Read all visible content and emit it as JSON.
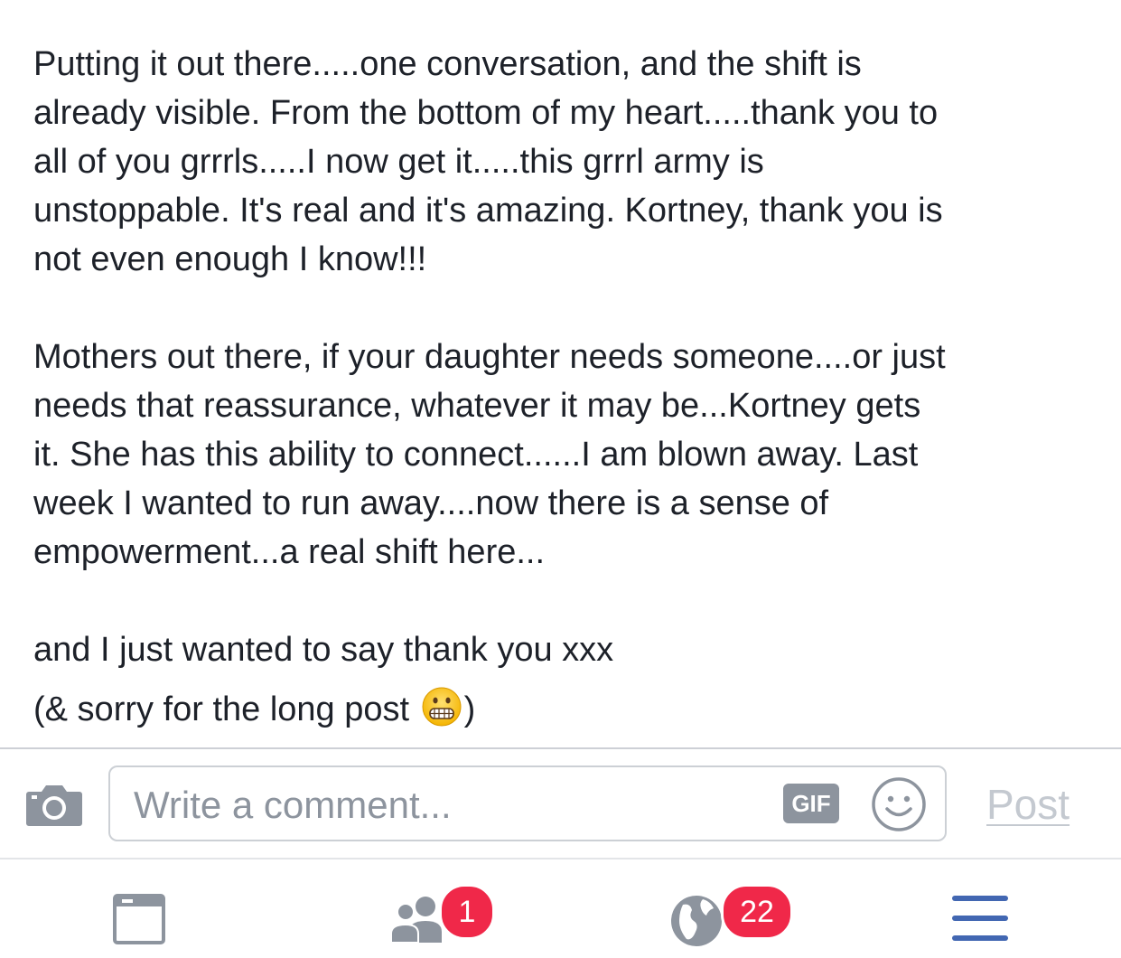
{
  "post": {
    "paragraph1": [
      "Putting it out there.....one conversation, and the shift is",
      "already visible. From the bottom of my heart.....thank you to",
      "all of you grrrls.....I now get it.....this grrrl army is",
      "unstoppable. It's real and it's amazing. Kortney, thank you is",
      "not even enough I know!!!"
    ],
    "paragraph2": [
      "Mothers out there, if your daughter needs someone....or just",
      "needs that reassurance, whatever it may be...Kortney gets",
      "it. She has this ability to connect......I am blown away. Last",
      "week I wanted to run away....now there is a sense of",
      "empowerment...a real shift here..."
    ],
    "closing_line1": "and I just wanted to say thank you xxx",
    "closing_line2_before": "(& sorry for the long post ",
    "closing_line2_after": ")",
    "emoji": "grimacing-face-emoji"
  },
  "composer": {
    "camera_icon": "camera-icon",
    "placeholder": "Write a comment...",
    "gif_label": "GIF",
    "sticker_icon": "smiley-icon",
    "post_label": "Post"
  },
  "tabbar": {
    "news_feed_icon": "news-feed-icon",
    "friends_icon": "friends-icon",
    "friends_badge": "1",
    "notifications_icon": "globe-icon",
    "notifications_badge": "22",
    "menu_icon": "menu-icon"
  },
  "colors": {
    "text": "#1d2129",
    "placeholder": "#8d949e",
    "icon_gray": "#8d949e",
    "badge_red": "#f02849",
    "menu_blue": "#4267b2",
    "post_disabled": "#c4c9d0"
  }
}
